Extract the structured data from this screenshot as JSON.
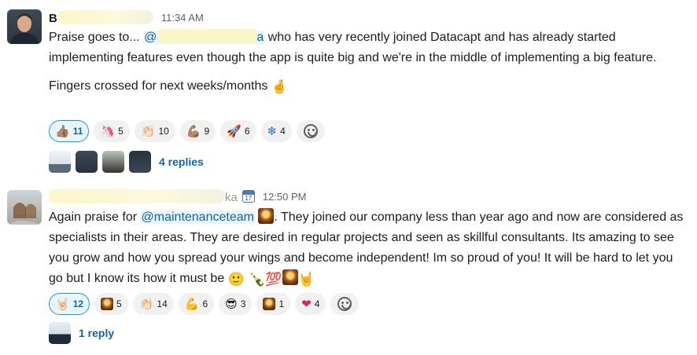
{
  "messages": [
    {
      "author": "B",
      "time": "11:34 AM",
      "text_intro": "Praise goes to... ",
      "mention": "@",
      "mention_tail": "a",
      "text_rest": " who has very recently joined Datacapt and has already started implementing features even though the app is quite big and we're in the middle of implementing a big feature.",
      "text_second": "Fingers crossed for next weeks/months",
      "emoji_end": "🤞",
      "reactions": [
        {
          "emoji": "👍🏽",
          "count": "11",
          "active": true
        },
        {
          "emoji": "🦄",
          "count": "5"
        },
        {
          "emoji": "👏🏻",
          "count": "10"
        },
        {
          "emoji": "💪🏽",
          "count": "9"
        },
        {
          "emoji": "🚀",
          "count": "6"
        },
        {
          "emoji": "❄",
          "count": "4"
        }
      ],
      "replies_label": "4 replies"
    },
    {
      "author_tail": "ka",
      "time": "12:50 PM",
      "calendar_icon": "calendar-icon",
      "text_intro": "Again praise for ",
      "mention": "@maintenanceteam",
      "text_rest": ". They joined our company less than year ago and now are considered as specialists in their areas. They are desired in regular projects and seen as skillful consultants. Its amazing to see you grow and how you spread your wings and become independent! Im so proud of you! It will be hard to let you go but I know its how it must be ",
      "emoji_end": "🙂 🍾💯",
      "reactions": [
        {
          "emoji": "🤘🏻",
          "count": "12",
          "active": true
        },
        {
          "emoji": "custom-image",
          "count": "5"
        },
        {
          "emoji": "👏🏻",
          "count": "14"
        },
        {
          "emoji": "💪",
          "count": "6"
        },
        {
          "emoji": "😎",
          "count": "3"
        },
        {
          "emoji": "custom-image",
          "count": "1"
        },
        {
          "emoji": "❤",
          "count": "4"
        }
      ],
      "replies_label": "1 reply"
    }
  ],
  "colors": {
    "link": "#1264a3",
    "active_border": "#1d9bd1",
    "active_bg": "#e8f5fa",
    "pill_bg": "#f1f1f1"
  }
}
